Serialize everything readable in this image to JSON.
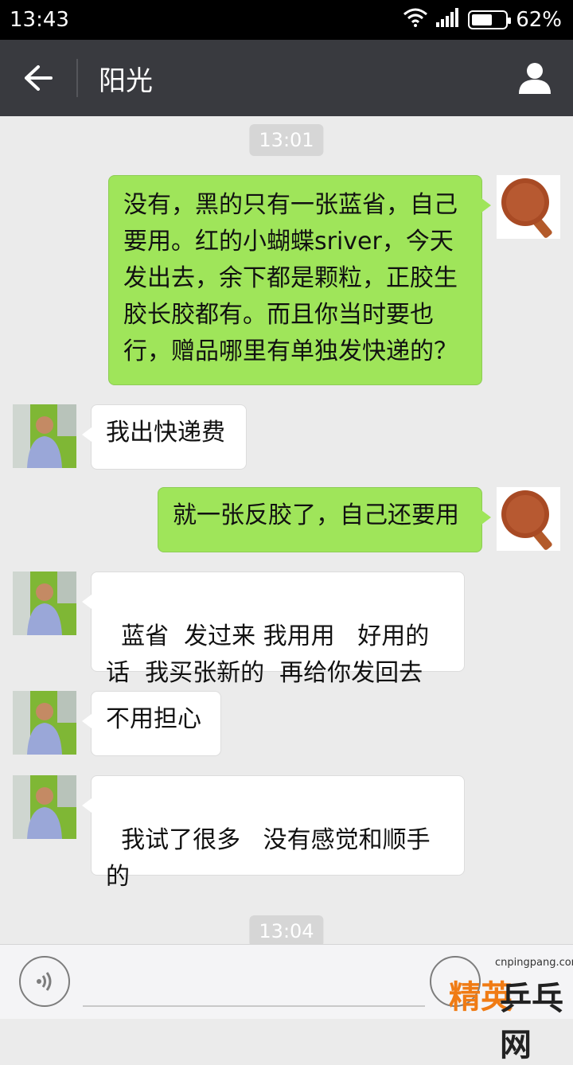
{
  "status_bar": {
    "time": "13:43",
    "battery": "62%",
    "battery_level": 0.62
  },
  "header": {
    "title": "阳光"
  },
  "timestamps": [
    "13:01",
    "13:04"
  ],
  "messages": [
    {
      "sender": "me",
      "text": "没有，黑的只有一张蓝省，自己要用。红的小蝴蝶sriver，今天发出去，余下都是颗粒，正胶生胶长胶都有。而且你当时要也行，赠品哪里有单独发快递的？"
    },
    {
      "sender": "other",
      "text": "我出快递费"
    },
    {
      "sender": "me",
      "text": "就一张反胶了，自己还要用"
    },
    {
      "sender": "other",
      "text": "蓝省  发过来 我用用   好用的话  我买张新的  再给你发回去"
    },
    {
      "sender": "other",
      "text": "不用担心"
    },
    {
      "sender": "other",
      "text": "我试了很多   没有感觉和顺手的"
    }
  ],
  "watermark": {
    "url": "cnpingpang.com",
    "brand_1": "精英",
    "brand_2": "乒乓网"
  },
  "colors": {
    "bubble_me": "#9fe55a",
    "bubble_other": "#ffffff",
    "title_bar": "#393a3f",
    "background": "#ebebeb"
  }
}
